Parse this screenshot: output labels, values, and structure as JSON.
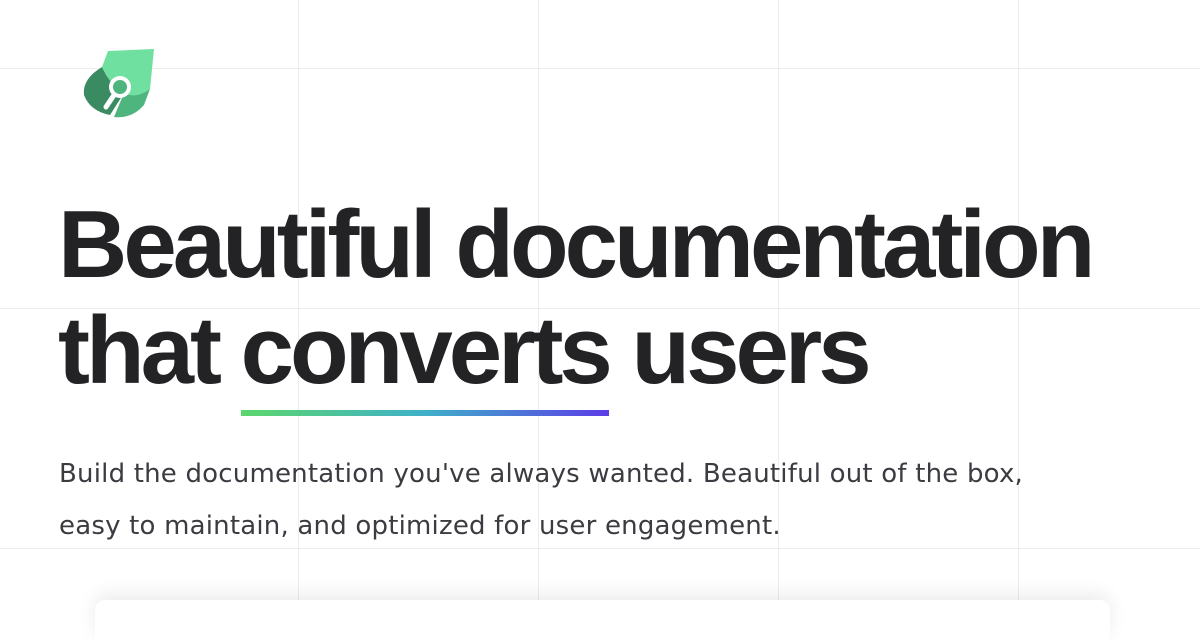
{
  "brand": {
    "logo_icon": "leaf-brush-icon",
    "colors": {
      "light": "#6fe0a0",
      "mid": "#4fb57f",
      "dark": "#3a8b62"
    }
  },
  "hero": {
    "headline_line1": "Beautiful documentation",
    "headline_line2_start": "that ",
    "headline_highlight": "converts",
    "headline_line2_end": " users",
    "underline_gradient": [
      "#5dd66b",
      "#3fb0c9",
      "#5b3de6"
    ],
    "subtitle_line1": "Build the documentation you've always wanted. Beautiful out of the box,",
    "subtitle_line2": "easy to maintain, and optimized for user engagement."
  }
}
